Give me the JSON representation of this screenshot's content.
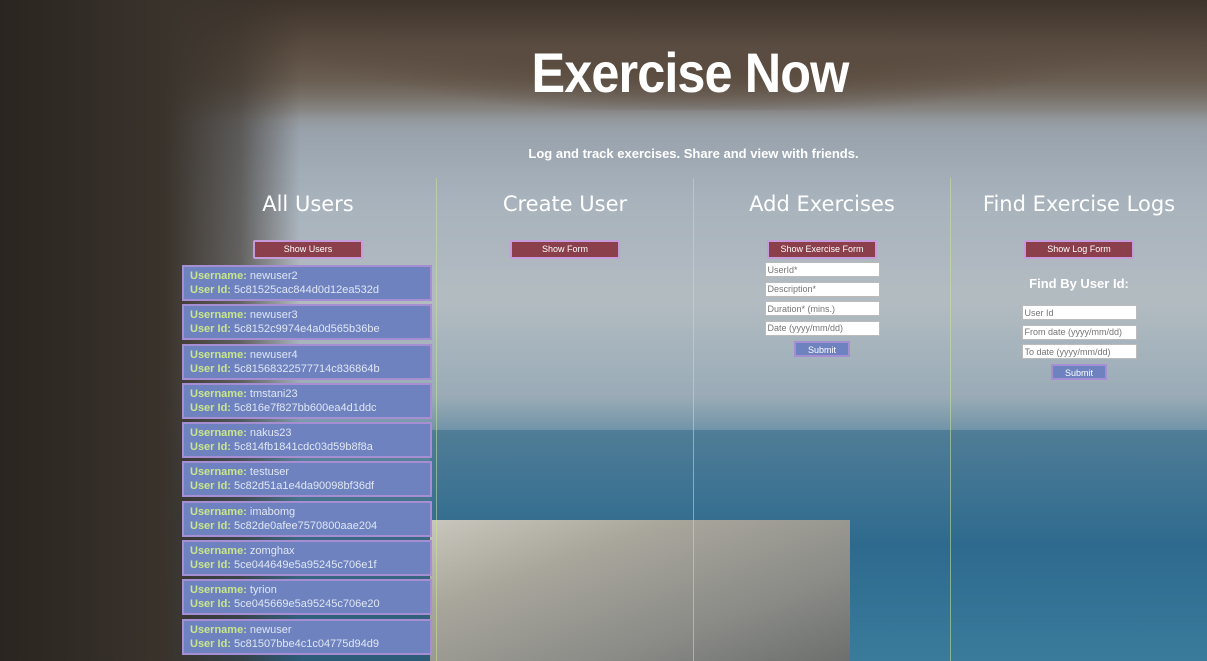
{
  "header": {
    "title": "Exercise Now",
    "subtitle": "Log and track exercises. Share and view with friends."
  },
  "columns": {
    "all_users": {
      "title": "All Users",
      "button": "Show Users",
      "username_label": "Username:",
      "userid_label": "User Id:",
      "users": [
        {
          "username": "newuser2",
          "id": "5c81525cac844d0d12ea532d"
        },
        {
          "username": "newuser3",
          "id": "5c8152c9974e4a0d565b36be"
        },
        {
          "username": "newuser4",
          "id": "5c81568322577714c836864b"
        },
        {
          "username": "tmstani23",
          "id": "5c816e7f827bb600ea4d1ddc"
        },
        {
          "username": "nakus23",
          "id": "5c814fb1841cdc03d59b8f8a"
        },
        {
          "username": "testuser",
          "id": "5c82d51a1e4da90098bf36df"
        },
        {
          "username": "imabomg",
          "id": "5c82de0afee7570800aae204"
        },
        {
          "username": "zomghax",
          "id": "5ce044649e5a95245c706e1f"
        },
        {
          "username": "tyrion",
          "id": "5ce045669e5a95245c706e20"
        },
        {
          "username": "newuser",
          "id": "5c81507bbe4c1c04775d94d9"
        }
      ]
    },
    "create_user": {
      "title": "Create User",
      "button": "Show Form"
    },
    "add_exercises": {
      "title": "Add Exercises",
      "button": "Show Exercise Form",
      "userid_placeholder": "UserId*",
      "description_placeholder": "Description*",
      "duration_placeholder": "Duration* (mins.)",
      "date_placeholder": "Date (yyyy/mm/dd)",
      "submit": "Submit"
    },
    "find_logs": {
      "title": "Find Exercise Logs",
      "button": "Show Log Form",
      "find_label": "Find By User Id:",
      "userid_placeholder": "User Id",
      "from_placeholder": "From date (yyyy/mm/dd)",
      "to_placeholder": "To date (yyyy/mm/dd)",
      "submit": "Submit"
    }
  },
  "colors": {
    "button_bg": "#8a3f4b",
    "button_border": "#c59bd9",
    "card_bg": "#6e82bf",
    "card_label": "#c9e68a"
  }
}
